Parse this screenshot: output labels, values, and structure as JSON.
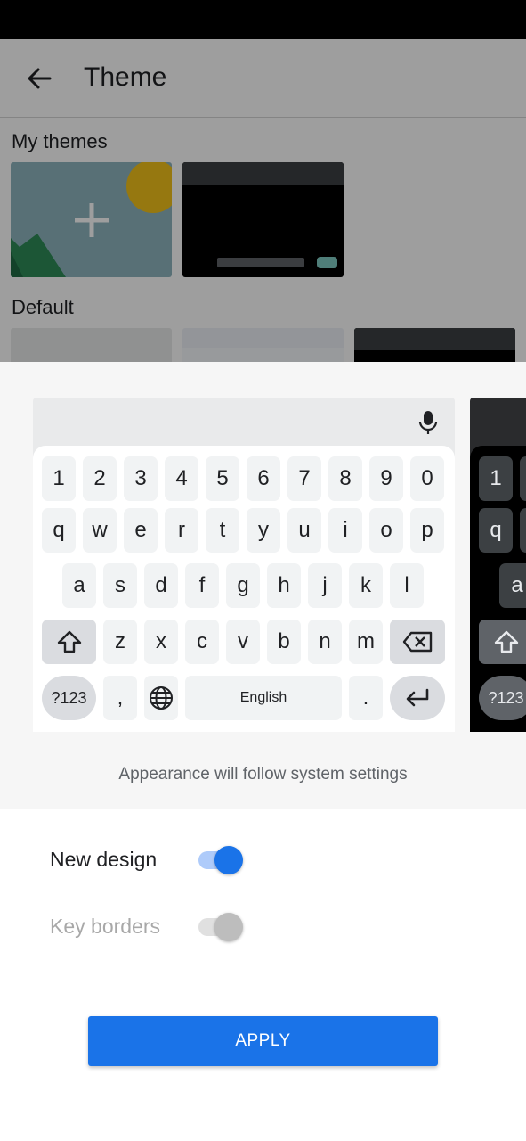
{
  "header": {
    "title": "Theme"
  },
  "sections": {
    "my_themes": "My themes",
    "default": "Default"
  },
  "icons": {
    "back": "back-arrow-icon",
    "add": "plus-icon",
    "mic": "mic-icon",
    "shift": "shift-icon",
    "backspace": "backspace-icon",
    "globe": "globe-icon",
    "enter": "enter-icon"
  },
  "keyboard": {
    "number_row": [
      "1",
      "2",
      "3",
      "4",
      "5",
      "6",
      "7",
      "8",
      "9",
      "0"
    ],
    "row1": [
      "q",
      "w",
      "e",
      "r",
      "t",
      "y",
      "u",
      "i",
      "o",
      "p"
    ],
    "row2": [
      "a",
      "s",
      "d",
      "f",
      "g",
      "h",
      "j",
      "k",
      "l"
    ],
    "row3": [
      "z",
      "x",
      "c",
      "v",
      "b",
      "n",
      "m"
    ],
    "symbols_key": "?123",
    "comma_key": ",",
    "space_key": "English",
    "period_key": "."
  },
  "dark_preview": {
    "num_key": "1",
    "q_key": "q",
    "a_key": "a",
    "symbols_key": "?123"
  },
  "appearance_note": "Appearance will follow system settings",
  "toggles": {
    "new_design": {
      "label": "New design",
      "on": true
    },
    "key_borders": {
      "label": "Key borders",
      "on": false,
      "enabled": false
    }
  },
  "apply_label": "APPLY",
  "colors": {
    "accent": "#1a73e8",
    "toggle_track_on": "#aecbfa",
    "toggle_off": "#bdbdbd",
    "dim_overlay": "rgba(0,0,0,0.38)"
  }
}
